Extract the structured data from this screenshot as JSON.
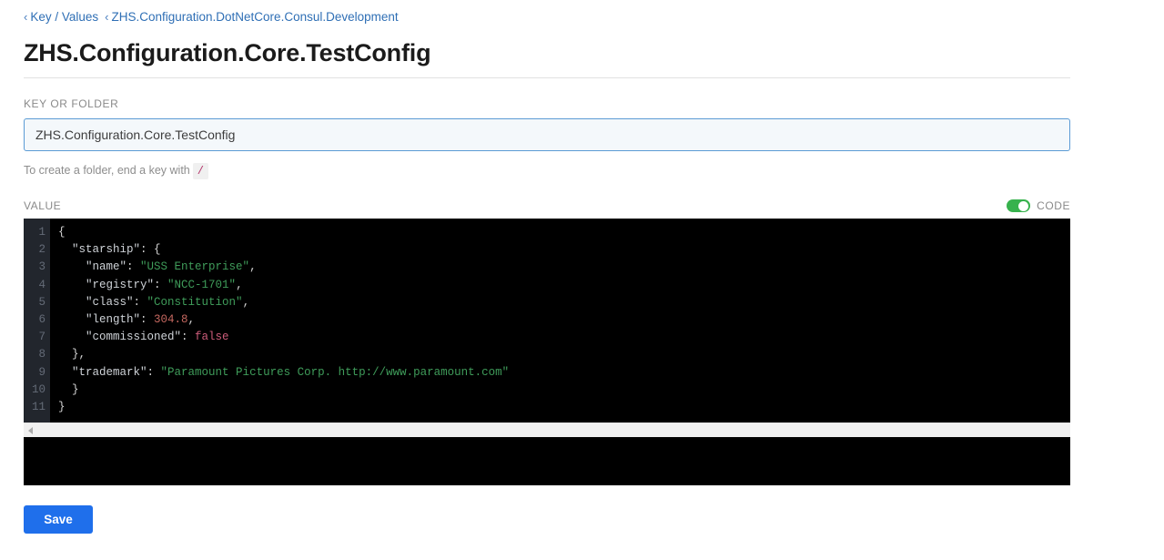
{
  "breadcrumb": {
    "chevron_glyph": "‹",
    "items": [
      {
        "label": "Key / Values"
      },
      {
        "label": "ZHS.Configuration.DotNetCore.Consul.Development"
      }
    ]
  },
  "page_title": "ZHS.Configuration.Core.TestConfig",
  "key_field": {
    "label": "KEY OR FOLDER",
    "value": "ZHS.Configuration.Core.TestConfig",
    "placeholder": "ZHS.Configuration.Core.TestConfig",
    "helper_prefix": "To create a folder, end a key with",
    "helper_code": "/"
  },
  "value_section": {
    "label": "VALUE",
    "toggle": {
      "label": "CODE",
      "state": "on",
      "on_color": "#37b24d"
    }
  },
  "editor": {
    "line_numbers": [
      "1",
      "2",
      "3",
      "4",
      "5",
      "6",
      "7",
      "8",
      "9",
      "10",
      "11"
    ],
    "lines": [
      [
        {
          "t": "{",
          "c": "punct"
        }
      ],
      [
        {
          "t": "  \"starship\"",
          "c": "key"
        },
        {
          "t": ": {",
          "c": "punct"
        }
      ],
      [
        {
          "t": "    \"name\"",
          "c": "key"
        },
        {
          "t": ": ",
          "c": "punct"
        },
        {
          "t": "\"USS Enterprise\"",
          "c": "str"
        },
        {
          "t": ",",
          "c": "punct"
        }
      ],
      [
        {
          "t": "    \"registry\"",
          "c": "key"
        },
        {
          "t": ": ",
          "c": "punct"
        },
        {
          "t": "\"NCC-1701\"",
          "c": "str"
        },
        {
          "t": ",",
          "c": "punct"
        }
      ],
      [
        {
          "t": "    \"class\"",
          "c": "key"
        },
        {
          "t": ": ",
          "c": "punct"
        },
        {
          "t": "\"Constitution\"",
          "c": "str"
        },
        {
          "t": ",",
          "c": "punct"
        }
      ],
      [
        {
          "t": "    \"length\"",
          "c": "key"
        },
        {
          "t": ": ",
          "c": "punct"
        },
        {
          "t": "304.8",
          "c": "num"
        },
        {
          "t": ",",
          "c": "punct"
        }
      ],
      [
        {
          "t": "    \"commissioned\"",
          "c": "key"
        },
        {
          "t": ": ",
          "c": "punct"
        },
        {
          "t": "false",
          "c": "bool"
        }
      ],
      [
        {
          "t": "  },",
          "c": "punct"
        }
      ],
      [
        {
          "t": "  \"trademark\"",
          "c": "key"
        },
        {
          "t": ": ",
          "c": "punct"
        },
        {
          "t": "\"Paramount Pictures Corp. http://www.paramount.com\"",
          "c": "str"
        }
      ],
      [
        {
          "t": "  }",
          "c": "punct"
        }
      ],
      [
        {
          "t": "}",
          "c": "punct"
        }
      ]
    ],
    "raw_value": "{\n  \"starship\": {\n    \"name\": \"USS Enterprise\",\n    \"registry\": \"NCC-1701\",\n    \"class\": \"Constitution\",\n    \"length\": 304.8,\n    \"commissioned\": false\n  },\n  \"trademark\": \"Paramount Pictures Corp. http://www.paramount.com\"\n  }\n}",
    "colors": {
      "background": "#000000",
      "gutter": "#22262d",
      "string": "#3f9c5a",
      "number": "#c4675f",
      "boolean": "#cd5c7a",
      "key": "#cfd3d8"
    }
  },
  "lower_panel": {
    "text": ""
  },
  "save_button": {
    "label": "Save",
    "color": "#1f6feb"
  }
}
